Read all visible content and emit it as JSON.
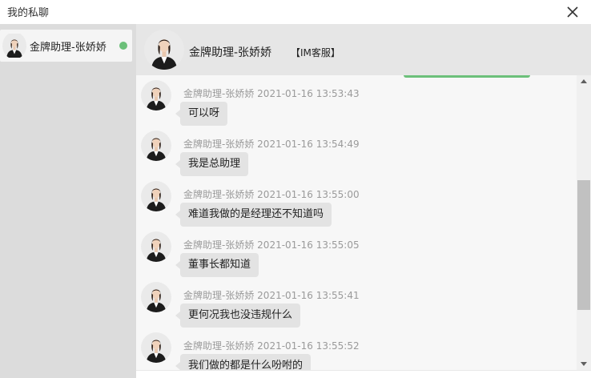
{
  "window": {
    "title": "我的私聊"
  },
  "contacts": [
    {
      "name": "金牌助理-张娇娇",
      "status_color": "#6cc07a"
    }
  ],
  "chat_header": {
    "name": "金牌助理-张娇娇",
    "tag": "【IM客服】"
  },
  "messages": [
    {
      "sender": "金牌助理-张娇娇",
      "time": "2021-01-16 13:53:43",
      "text": "可以呀"
    },
    {
      "sender": "金牌助理-张娇娇",
      "time": "2021-01-16 13:54:49",
      "text": "我是总助理"
    },
    {
      "sender": "金牌助理-张娇娇",
      "time": "2021-01-16 13:55:00",
      "text": "难道我做的是经理还不知道吗"
    },
    {
      "sender": "金牌助理-张娇娇",
      "time": "2021-01-16 13:55:05",
      "text": "董事长都知道"
    },
    {
      "sender": "金牌助理-张娇娇",
      "time": "2021-01-16 13:55:41",
      "text": "更何况我也没违规什么"
    },
    {
      "sender": "金牌助理-张娇娇",
      "time": "2021-01-16 13:55:52",
      "text": "我们做的都是什么吩咐的"
    }
  ],
  "colors": {
    "online": "#6cc07a",
    "bubble": "#e3e3e3",
    "sidebar": "#dcdcdc",
    "header": "#e6e6e6"
  }
}
